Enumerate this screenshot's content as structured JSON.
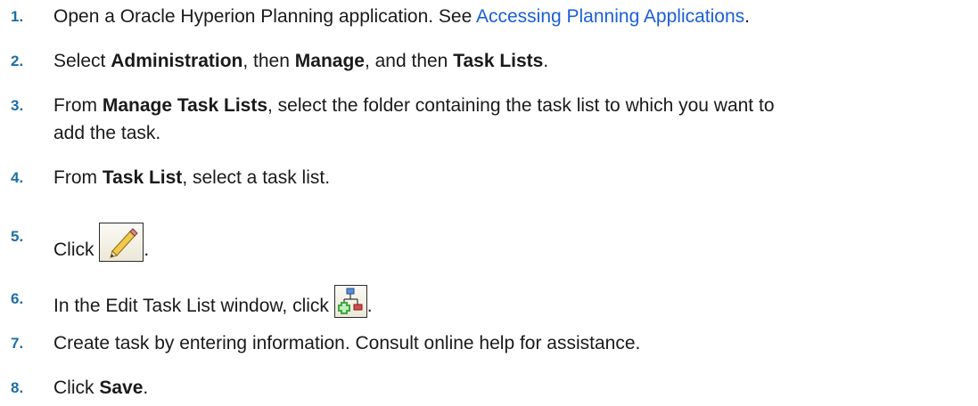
{
  "steps": [
    {
      "num": "1.",
      "pre": "Open a Oracle Hyperion Planning application. See ",
      "link": "Accessing Planning Applications",
      "post": "."
    },
    {
      "num": "2.",
      "t1": "Select ",
      "b1": "Administration",
      "t2": ", then ",
      "b2": "Manage",
      "t3": ", and then ",
      "b3": "Task Lists",
      "t4": "."
    },
    {
      "num": "3.",
      "t1": "From ",
      "b1": "Manage Task Lists",
      "t2": ", select the folder containing the task list to which you want to",
      "line2": "add the task."
    },
    {
      "num": "4.",
      "t1": "From ",
      "b1": "Task List",
      "t2": ", select a task list."
    },
    {
      "num": "5.",
      "t1": "Click ",
      "icon": "pencil-icon",
      "t2": "."
    },
    {
      "num": "6.",
      "t1": "In the Edit Task List window, click ",
      "icon": "add-task-icon",
      "t2": "."
    },
    {
      "num": "7.",
      "t1": "Create task by entering information. Consult online help for assistance."
    },
    {
      "num": "8.",
      "t1": "Click ",
      "b1": "Save",
      "t2": "."
    }
  ],
  "colors": {
    "step_number": "#1d6fa5",
    "link": "#1a5fd6",
    "text": "#1a1a1a"
  }
}
